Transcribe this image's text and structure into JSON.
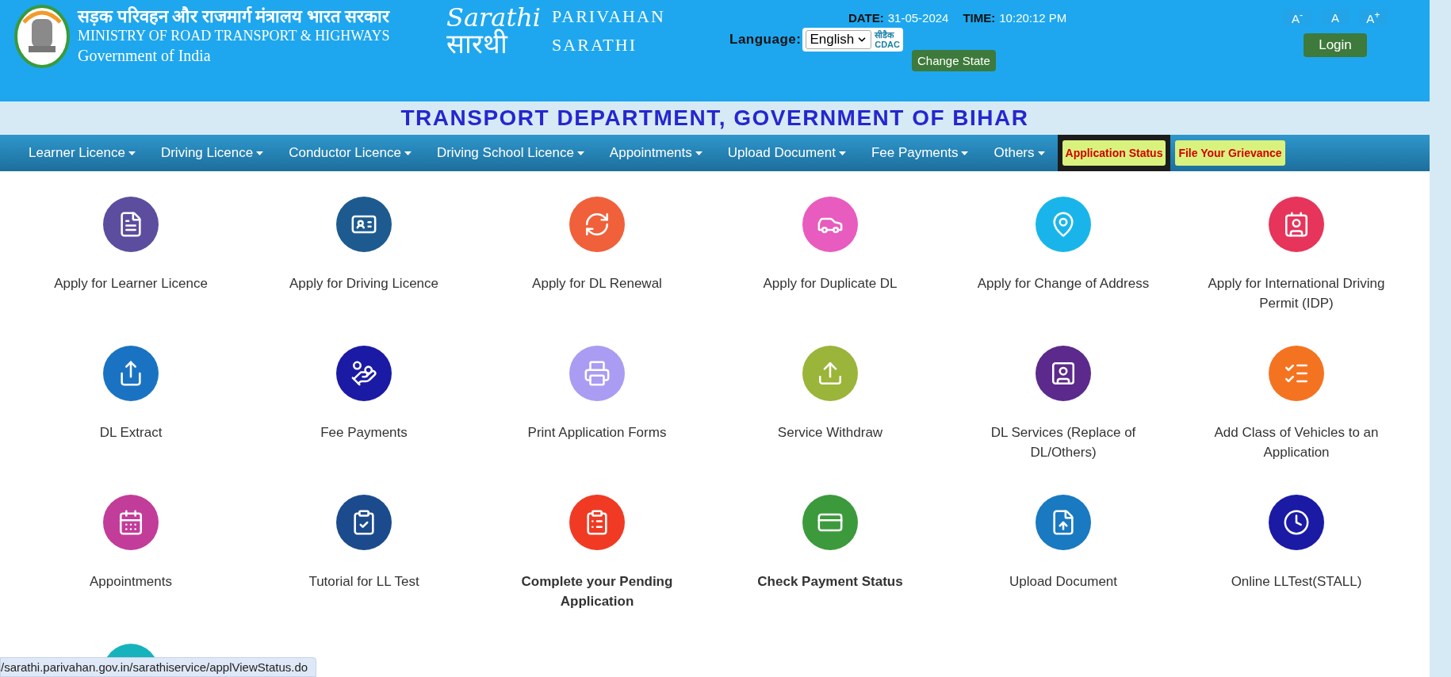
{
  "header": {
    "ministry_hindi": "सड़क परिवहन और राजमार्ग मंत्रालय भारत सरकार",
    "ministry": "MINISTRY OF ROAD TRANSPORT & HIGHWAYS",
    "government": "Government of India",
    "logo_latin": "Sarathi",
    "logo_hindi": "सारथी",
    "brand_line_1": "PARIVAHAN",
    "brand_line_2": "SARATHI",
    "date_label": "DATE:",
    "date": "31-05-2024",
    "time_label": "TIME:",
    "time": "10:20:12 PM",
    "language_label": "Language:",
    "language": "English",
    "cdac_hindi": "सीडैक",
    "cdac": "CDAC",
    "change_state": "Change State",
    "font_buttons": [
      "A$^{-}$",
      "A",
      "A$^{+}$"
    ],
    "login": "Login"
  },
  "title": "TRANSPORT DEPARTMENT, GOVERNMENT OF BIHAR",
  "nav": [
    {
      "label": "Learner Licence",
      "kind": "dropdown",
      "selected": false
    },
    {
      "label": "Driving Licence",
      "kind": "dropdown",
      "selected": false
    },
    {
      "label": "Conductor Licence",
      "kind": "dropdown",
      "selected": false
    },
    {
      "label": "Driving School Licence",
      "kind": "dropdown",
      "selected": false
    },
    {
      "label": "Appointments",
      "kind": "dropdown",
      "selected": false
    },
    {
      "label": "Upload Document",
      "kind": "dropdown",
      "selected": false
    },
    {
      "label": "Fee Payments",
      "kind": "dropdown",
      "selected": false
    },
    {
      "label": "Others",
      "kind": "dropdown",
      "selected": false
    },
    {
      "label": "Application Status",
      "kind": "highlight",
      "selected": true
    },
    {
      "label": "File Your Grievance",
      "kind": "highlight",
      "selected": false
    }
  ],
  "services": [
    {
      "label": "Apply for Learner Licence",
      "color": "#5c4d9e",
      "bold": false
    },
    {
      "label": "Apply for Driving Licence",
      "color": "#1d5a8f",
      "bold": false
    },
    {
      "label": "Apply for DL Renewal",
      "color": "#f0603a",
      "bold": false
    },
    {
      "label": "Apply for Duplicate DL",
      "color": "#e85bbf",
      "bold": false
    },
    {
      "label": "Apply for Change of Address",
      "color": "#19b5ea",
      "bold": false
    },
    {
      "label": "Apply for International Driving Permit (IDP)",
      "color": "#e6345a",
      "bold": false
    },
    {
      "label": "DL Extract",
      "color": "#1a73c2",
      "bold": false
    },
    {
      "label": "Fee Payments",
      "color": "#1b1aa5",
      "bold": false
    },
    {
      "label": "Print Application Forms",
      "color": "#a99cf2",
      "bold": false
    },
    {
      "label": "Service Withdraw",
      "color": "#9bb43a",
      "bold": false
    },
    {
      "label": "DL Services (Replace of DL/Others)",
      "color": "#5b2a8c",
      "bold": false
    },
    {
      "label": "Add Class of Vehicles to an Application",
      "color": "#f47321",
      "bold": false
    },
    {
      "label": "Appointments",
      "color": "#c23c9a",
      "bold": false
    },
    {
      "label": "Tutorial for LL Test",
      "color": "#1b4b8c",
      "bold": false
    },
    {
      "label": "Complete your Pending Application",
      "color": "#f03a23",
      "bold": true
    },
    {
      "label": "Check Payment Status",
      "color": "#3c9a3c",
      "bold": true
    },
    {
      "label": "Upload Document",
      "color": "#1979c1",
      "bold": false
    },
    {
      "label": "Online LLTest(STALL)",
      "color": "#1a1aa5",
      "bold": false
    },
    {
      "color": "#16b3bd"
    }
  ],
  "status_bar": "/sarathi.parivahan.gov.in/sarathiservice/applViewStatus.do"
}
